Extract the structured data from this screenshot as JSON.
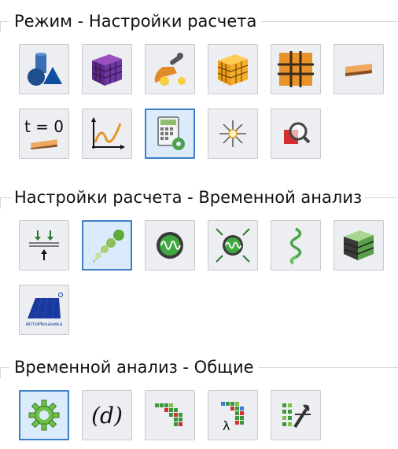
{
  "sections": [
    {
      "title": "Режим - Настройки расчета",
      "buttons": [
        {
          "icon": "shapes-icon",
          "selected": false
        },
        {
          "icon": "mesh-cube-purple-icon",
          "selected": false
        },
        {
          "icon": "tools-icon",
          "selected": false
        },
        {
          "icon": "mesh-cube-orange-icon",
          "selected": false
        },
        {
          "icon": "grid-icon",
          "selected": false
        },
        {
          "icon": "beam-icon",
          "selected": false
        },
        {
          "icon": "initial-state-icon",
          "label": "t = 0",
          "selected": false
        },
        {
          "icon": "graph-icon",
          "selected": false
        },
        {
          "icon": "calculator-settings-icon",
          "selected": true
        },
        {
          "icon": "sparkle-icon",
          "selected": false
        },
        {
          "icon": "inspect-icon",
          "selected": false
        }
      ]
    },
    {
      "title": "Настройки расчета - Временной анализ",
      "buttons": [
        {
          "icon": "supports-icon",
          "selected": false
        },
        {
          "icon": "trajectory-icon",
          "selected": true
        },
        {
          "icon": "oscillator-icon",
          "selected": false
        },
        {
          "icon": "oscillator-forces-icon",
          "selected": false
        },
        {
          "icon": "spiral-icon",
          "selected": false
        },
        {
          "icon": "layered-box-icon",
          "selected": false
        },
        {
          "icon": "logo-icon",
          "label": "АптоМеханика",
          "selected": false
        }
      ]
    },
    {
      "title": "Временной анализ - Общие",
      "buttons": [
        {
          "icon": "gear-icon",
          "selected": true
        },
        {
          "icon": "parameter-d-icon",
          "label": "(d)",
          "selected": false
        },
        {
          "icon": "matrix-icon",
          "selected": false
        },
        {
          "icon": "matrix-lambda-icon",
          "label": "λ",
          "selected": false
        },
        {
          "icon": "list-settings-icon",
          "selected": false
        }
      ]
    }
  ],
  "colors": {
    "selected_border": "#3c7fc6",
    "selected_bg": "#dcebfb",
    "button_bg": "#eceef1"
  }
}
